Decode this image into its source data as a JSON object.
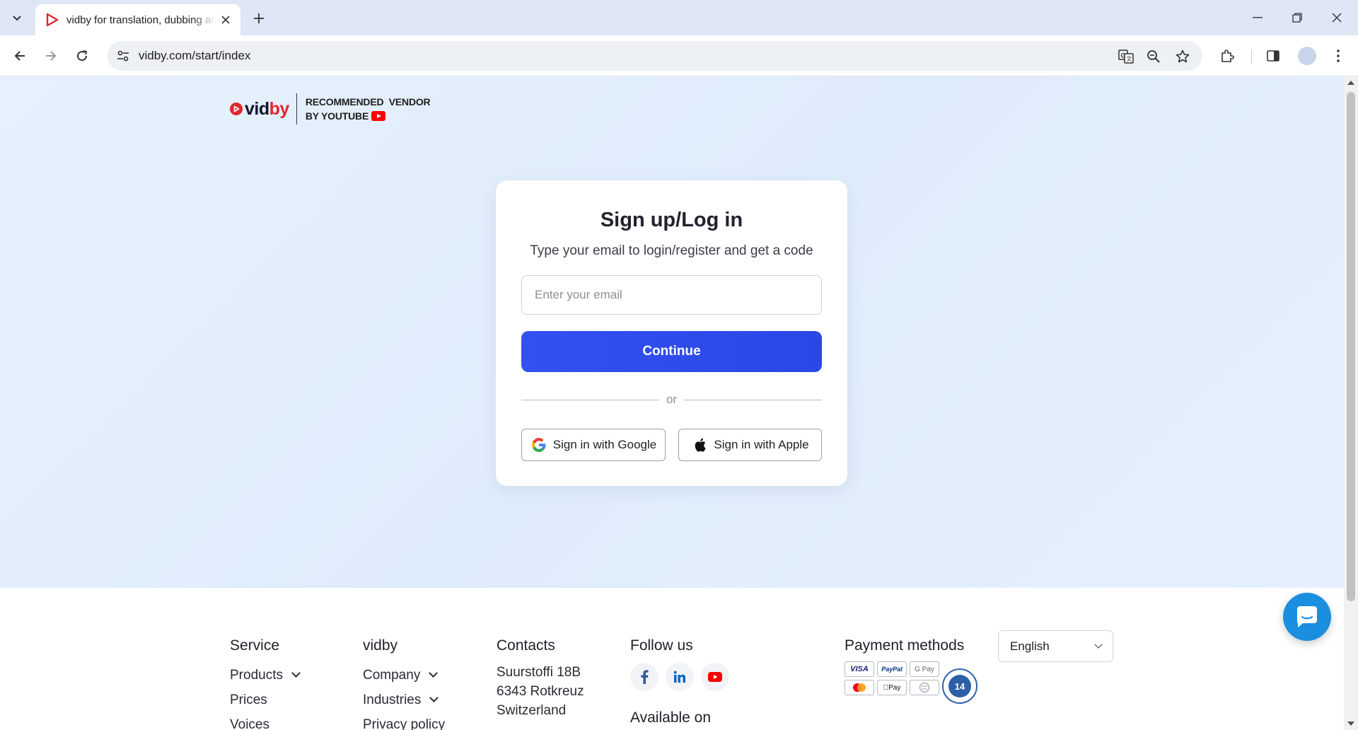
{
  "browser": {
    "tab_title": "vidby for translation, dubbing and voiceover",
    "url": "vidby.com/start/index"
  },
  "header": {
    "logo_text": "vidby",
    "vendor_line1": "RECOMMENDED  VENDOR",
    "vendor_line2": "BY YOUTUBE"
  },
  "login": {
    "title": "Sign up/Log in",
    "subtitle": "Type your email to login/register and get a code",
    "email_placeholder": "Enter your email",
    "email_value": "",
    "continue_label": "Continue",
    "or_label": "or",
    "google_label": "Sign in with Google",
    "apple_label": "Sign in with Apple"
  },
  "footer": {
    "service": {
      "heading": "Service",
      "items": [
        "Products",
        "Prices",
        "Voices"
      ]
    },
    "vidby": {
      "heading": "vidby",
      "items": [
        "Company",
        "Industries",
        "Privacy policy"
      ]
    },
    "contacts": {
      "heading": "Contacts",
      "address_line1": "Suurstoffi 18B",
      "address_line2": "6343 Rotkreuz",
      "address_line3": "Switzerland"
    },
    "follow": {
      "heading": "Follow us",
      "available_heading": "Available on",
      "icons": [
        "facebook-icon",
        "linkedin-icon",
        "youtube-icon"
      ]
    },
    "payment": {
      "heading": "Payment methods",
      "methods": [
        "VISA",
        "PayPal",
        "G Pay",
        "Mastercard",
        "Apple Pay",
        "Wire"
      ],
      "guarantee_days": "14"
    },
    "language": {
      "selected": "English"
    }
  },
  "colors": {
    "brand_red": "#e3262e",
    "primary_blue": "#3350f0",
    "hero_bg": "#e2eefb",
    "chat_blue": "#1a8fe0"
  }
}
